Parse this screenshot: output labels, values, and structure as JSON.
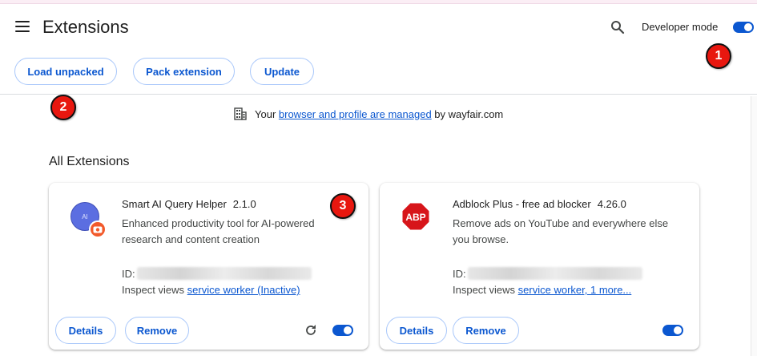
{
  "header": {
    "title": "Extensions",
    "developer_mode_label": "Developer mode",
    "developer_mode_on": true,
    "buttons": {
      "load_unpacked": "Load unpacked",
      "pack_extension": "Pack extension",
      "update": "Update"
    }
  },
  "managed_notice": {
    "prefix": "Your ",
    "link": "browser and profile are managed",
    "suffix": " by wayfair.com"
  },
  "section_title": "All Extensions",
  "annotations": [
    "1",
    "2",
    "3"
  ],
  "extensions": [
    {
      "name": "Smart AI Query Helper",
      "version": "2.1.0",
      "description": "Enhanced productivity tool for AI-powered research and content creation",
      "icon": "ai-logo-icon",
      "icon_text": "AI",
      "id_label": "ID:",
      "inspect_label": "Inspect views",
      "inspect_link": "service worker (Inactive)",
      "details_label": "Details",
      "remove_label": "Remove",
      "enabled": true,
      "has_reload": true
    },
    {
      "name": "Adblock Plus - free ad blocker",
      "version": "4.26.0",
      "description": "Remove ads on YouTube and everywhere else you browse.",
      "icon": "abp-octagon-icon",
      "icon_text": "ABP",
      "id_label": "ID:",
      "inspect_label": "Inspect views",
      "inspect_link": "service worker, 1 more...",
      "details_label": "Details",
      "remove_label": "Remove",
      "enabled": true,
      "has_reload": false
    }
  ],
  "colors": {
    "accent": "#0b57d0",
    "badge_red": "#e8170f",
    "abp_red": "#d7151a"
  }
}
